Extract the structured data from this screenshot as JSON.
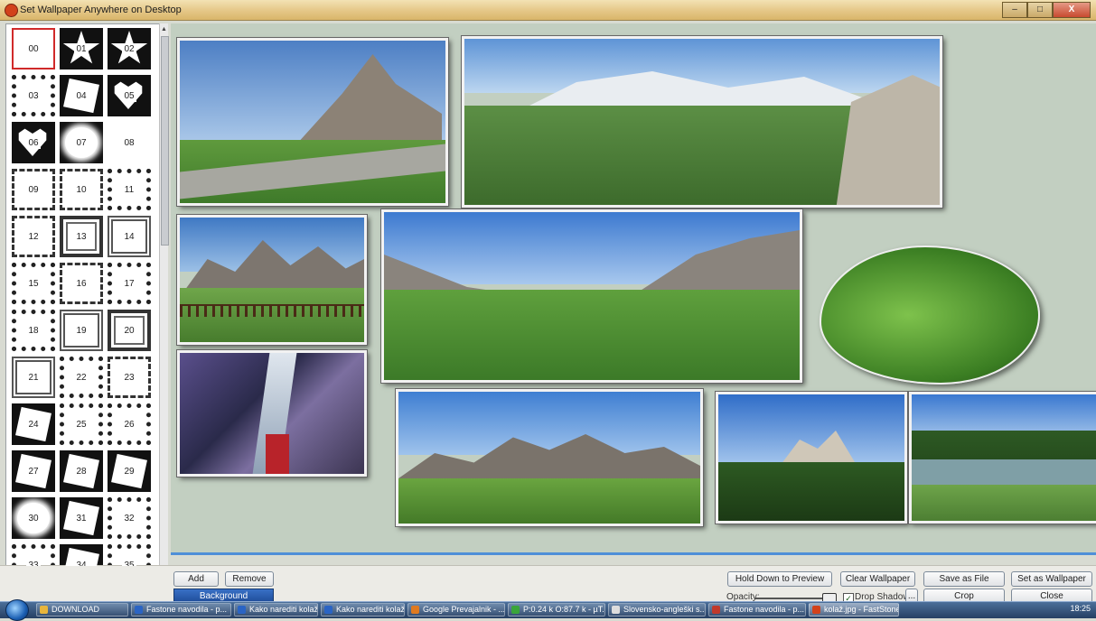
{
  "window": {
    "title": "Set Wallpaper Anywhere on Desktop",
    "controls": [
      "–",
      "□",
      "X"
    ]
  },
  "thumbnails": [
    "00",
    "01",
    "02",
    "03",
    "04",
    "05",
    "06",
    "07",
    "08",
    "09",
    "10",
    "11",
    "12",
    "13",
    "14",
    "15",
    "16",
    "17",
    "18",
    "19",
    "20",
    "21",
    "22",
    "23",
    "24",
    "25",
    "26",
    "27",
    "28",
    "29",
    "30",
    "31",
    "32",
    "33",
    "34",
    "35"
  ],
  "selected_thumbnail": "00",
  "buttons": {
    "add": "Add",
    "remove": "Remove",
    "background": "Background",
    "hold_preview": "Hold Down to Preview",
    "clear_wallpaper": "Clear Wallpaper",
    "save_as_file": "Save as File",
    "set_as_wallpaper": "Set as Wallpaper",
    "crop": "Crop",
    "close": "Close",
    "more": "..."
  },
  "opacity": {
    "label": "Opacity:"
  },
  "drop_shadow": {
    "label": "Drop Shadow",
    "checked": true,
    "check_glyph": "✓"
  },
  "taskbar": {
    "items": [
      {
        "label": "DOWNLOAD",
        "color": "#e8b53c"
      },
      {
        "label": "Fastone navodila - p...",
        "color": "#2a64c4"
      },
      {
        "label": "Kako narediti kolaž f...",
        "color": "#2a64c4"
      },
      {
        "label": "Kako narediti kolaž f...",
        "color": "#2a64c4"
      },
      {
        "label": "Google Prevajalnik - ...",
        "color": "#e07a1f"
      },
      {
        "label": "P:0.24 k O:87.7 k - µT...",
        "color": "#3aa53a"
      },
      {
        "label": "Slovensko-angleški s...",
        "color": "#dddddd"
      },
      {
        "label": "Fastone navodila - p...",
        "color": "#c0392b"
      },
      {
        "label": "kolaž.jpg - FastStone",
        "color": "#d2421b",
        "active": true
      }
    ],
    "clock": "18:25"
  }
}
